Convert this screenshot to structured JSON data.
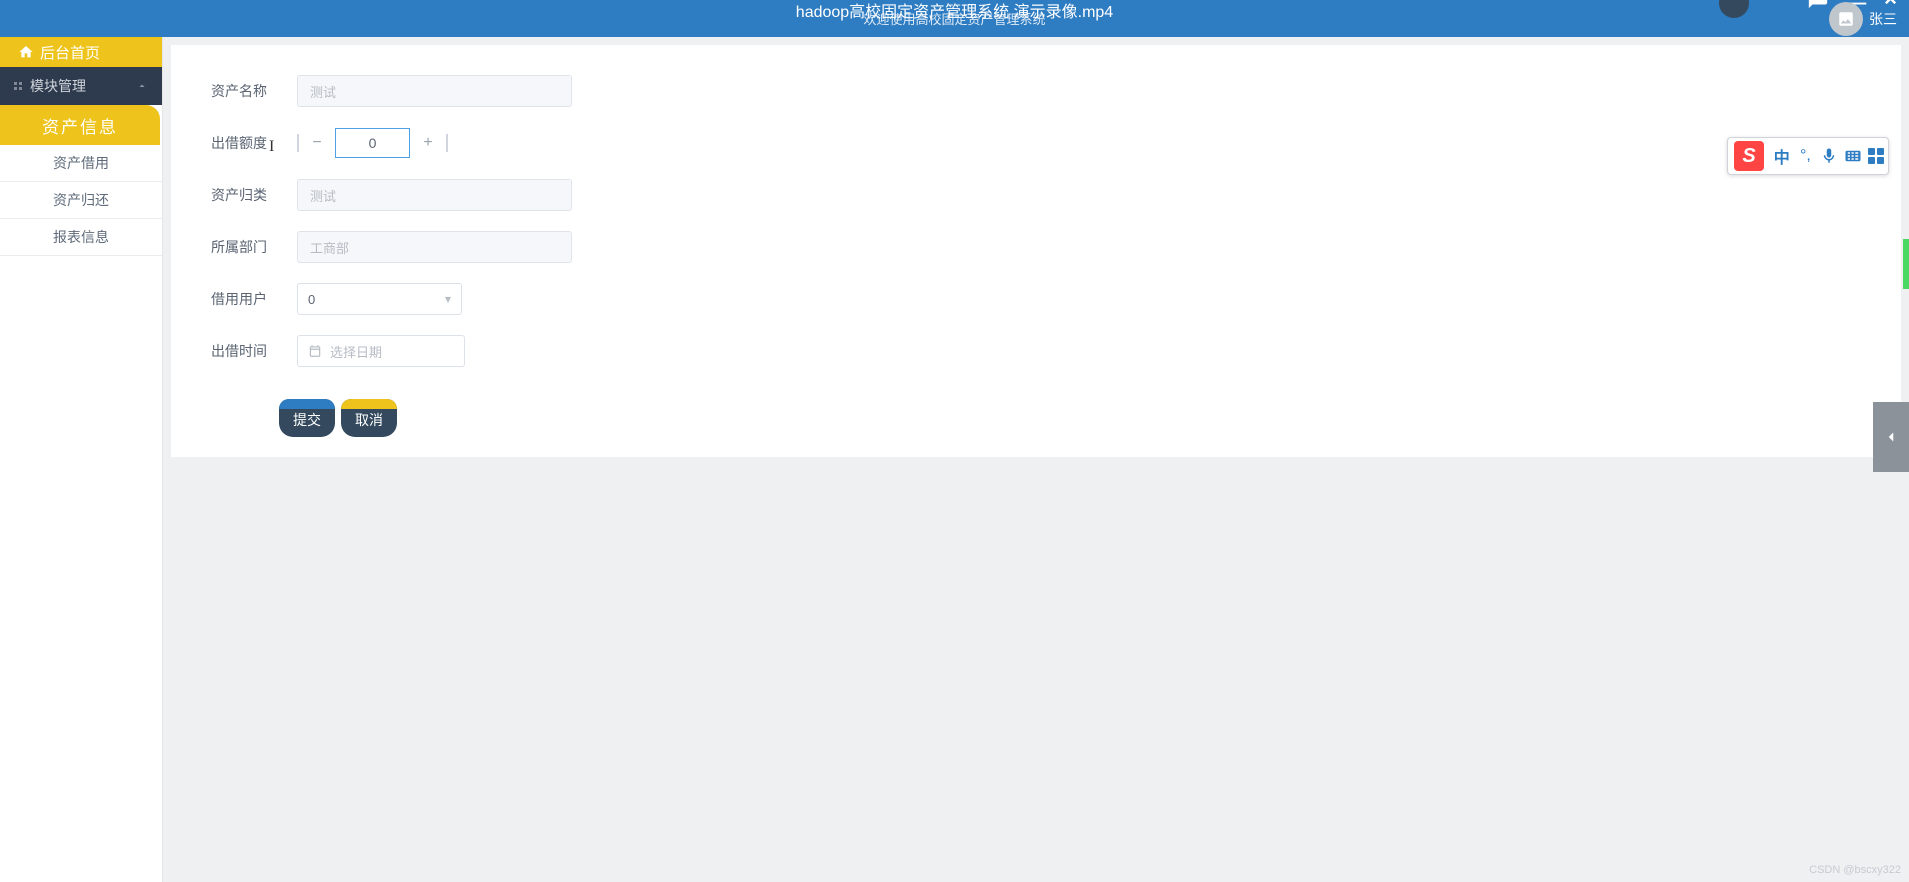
{
  "titlebar": {
    "main_overlap": "hadoop高校固定资产管理系统 演示录像.mp4",
    "subtitle": "欢迎使用高校固定资产管理系统",
    "username": "张三"
  },
  "sidebar": {
    "home_label": "后台首页",
    "section_label": "模块管理",
    "active_label": "资产信息",
    "items": [
      "资产借用",
      "资产归还",
      "报表信息"
    ]
  },
  "form": {
    "asset_name_label": "资产名称",
    "asset_name_value": "测试",
    "loan_amount_label": "出借额度",
    "loan_amount_value": "0",
    "asset_category_label": "资产归类",
    "asset_category_value": "测试",
    "department_label": "所属部门",
    "department_value": "工商部",
    "borrow_user_label": "借用用户",
    "borrow_user_value": "0",
    "loan_time_label": "出借时间",
    "date_placeholder": "选择日期",
    "submit_label": "提交",
    "cancel_label": "取消"
  },
  "ime": {
    "logo": "S",
    "lang": "中"
  },
  "watermark": "CSDN @bscxy322"
}
